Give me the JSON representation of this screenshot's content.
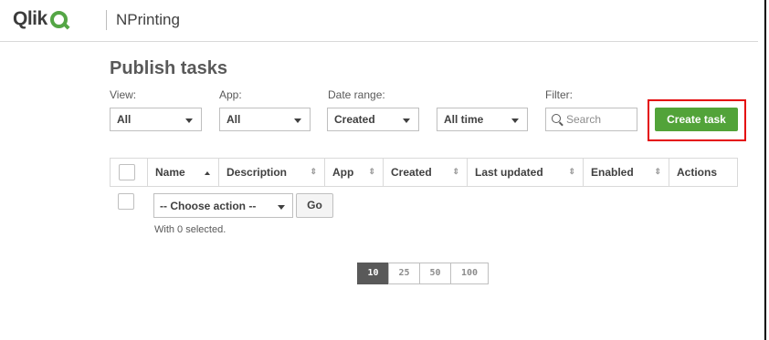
{
  "header": {
    "logo_text": "Qlik",
    "app_name": "NPrinting"
  },
  "page": {
    "title": "Publish tasks"
  },
  "filters": {
    "view_label": "View:",
    "view_value": "All",
    "app_label": "App:",
    "app_value": "All",
    "date_range_label": "Date range:",
    "date_range_field": "Created",
    "date_range_period": "All time",
    "filter_label": "Filter:",
    "search_placeholder": "Search"
  },
  "actions": {
    "create_task": "Create task",
    "choose_action": "-- Choose action --",
    "go": "Go",
    "selected_text": "With 0 selected."
  },
  "table": {
    "columns": [
      "Name",
      "Description",
      "App",
      "Created",
      "Last updated",
      "Enabled",
      "Actions"
    ]
  },
  "pagination": {
    "sizes": [
      "10",
      "25",
      "50",
      "100"
    ],
    "active": "10"
  },
  "colors": {
    "brand_green": "#54a645",
    "button_green": "#52a339",
    "highlight_red": "#e4080a"
  }
}
